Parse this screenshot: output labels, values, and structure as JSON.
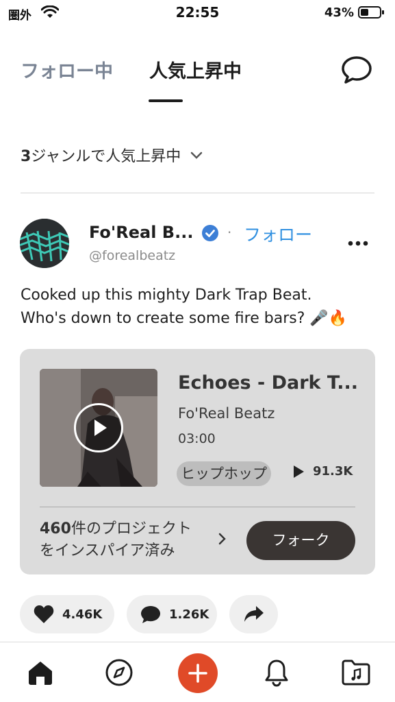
{
  "status_bar": {
    "carrier": "圏外",
    "time": "22:55",
    "battery": "43%",
    "battery_level": 0.43
  },
  "header": {
    "tabs": [
      {
        "label": "フォロー中",
        "active": false
      },
      {
        "label": "人気上昇中",
        "active": true
      }
    ],
    "chat_icon": "chat-bubble-icon"
  },
  "filter": {
    "count": "3",
    "label": "ジャンルで人気上昇中"
  },
  "post": {
    "author_name": "Fo'Real B...",
    "handle": "@forealbeatz",
    "follow_label": "フォロー",
    "separator": "·",
    "text_line1": "Cooked up this mighty Dark Trap Beat.",
    "text_line2": "Who's down to create some fire bars? 🎤🔥",
    "beat": {
      "title": "Echoes - Dark T...",
      "artist": "Fo'Real Beatz",
      "duration": "03:00",
      "genre": "ヒップホップ",
      "plays": "91.3K"
    },
    "inspired_count": "460",
    "inspired_line1": "件のプロジェクト",
    "inspired_line2": "をインスパイア済み",
    "fork_label": "フォーク",
    "likes": "4.46K",
    "comments": "1.26K"
  },
  "colors": {
    "accent_blue": "#2f8fe0",
    "create_red": "#e04a28",
    "card_bg": "#dcdcdc"
  }
}
